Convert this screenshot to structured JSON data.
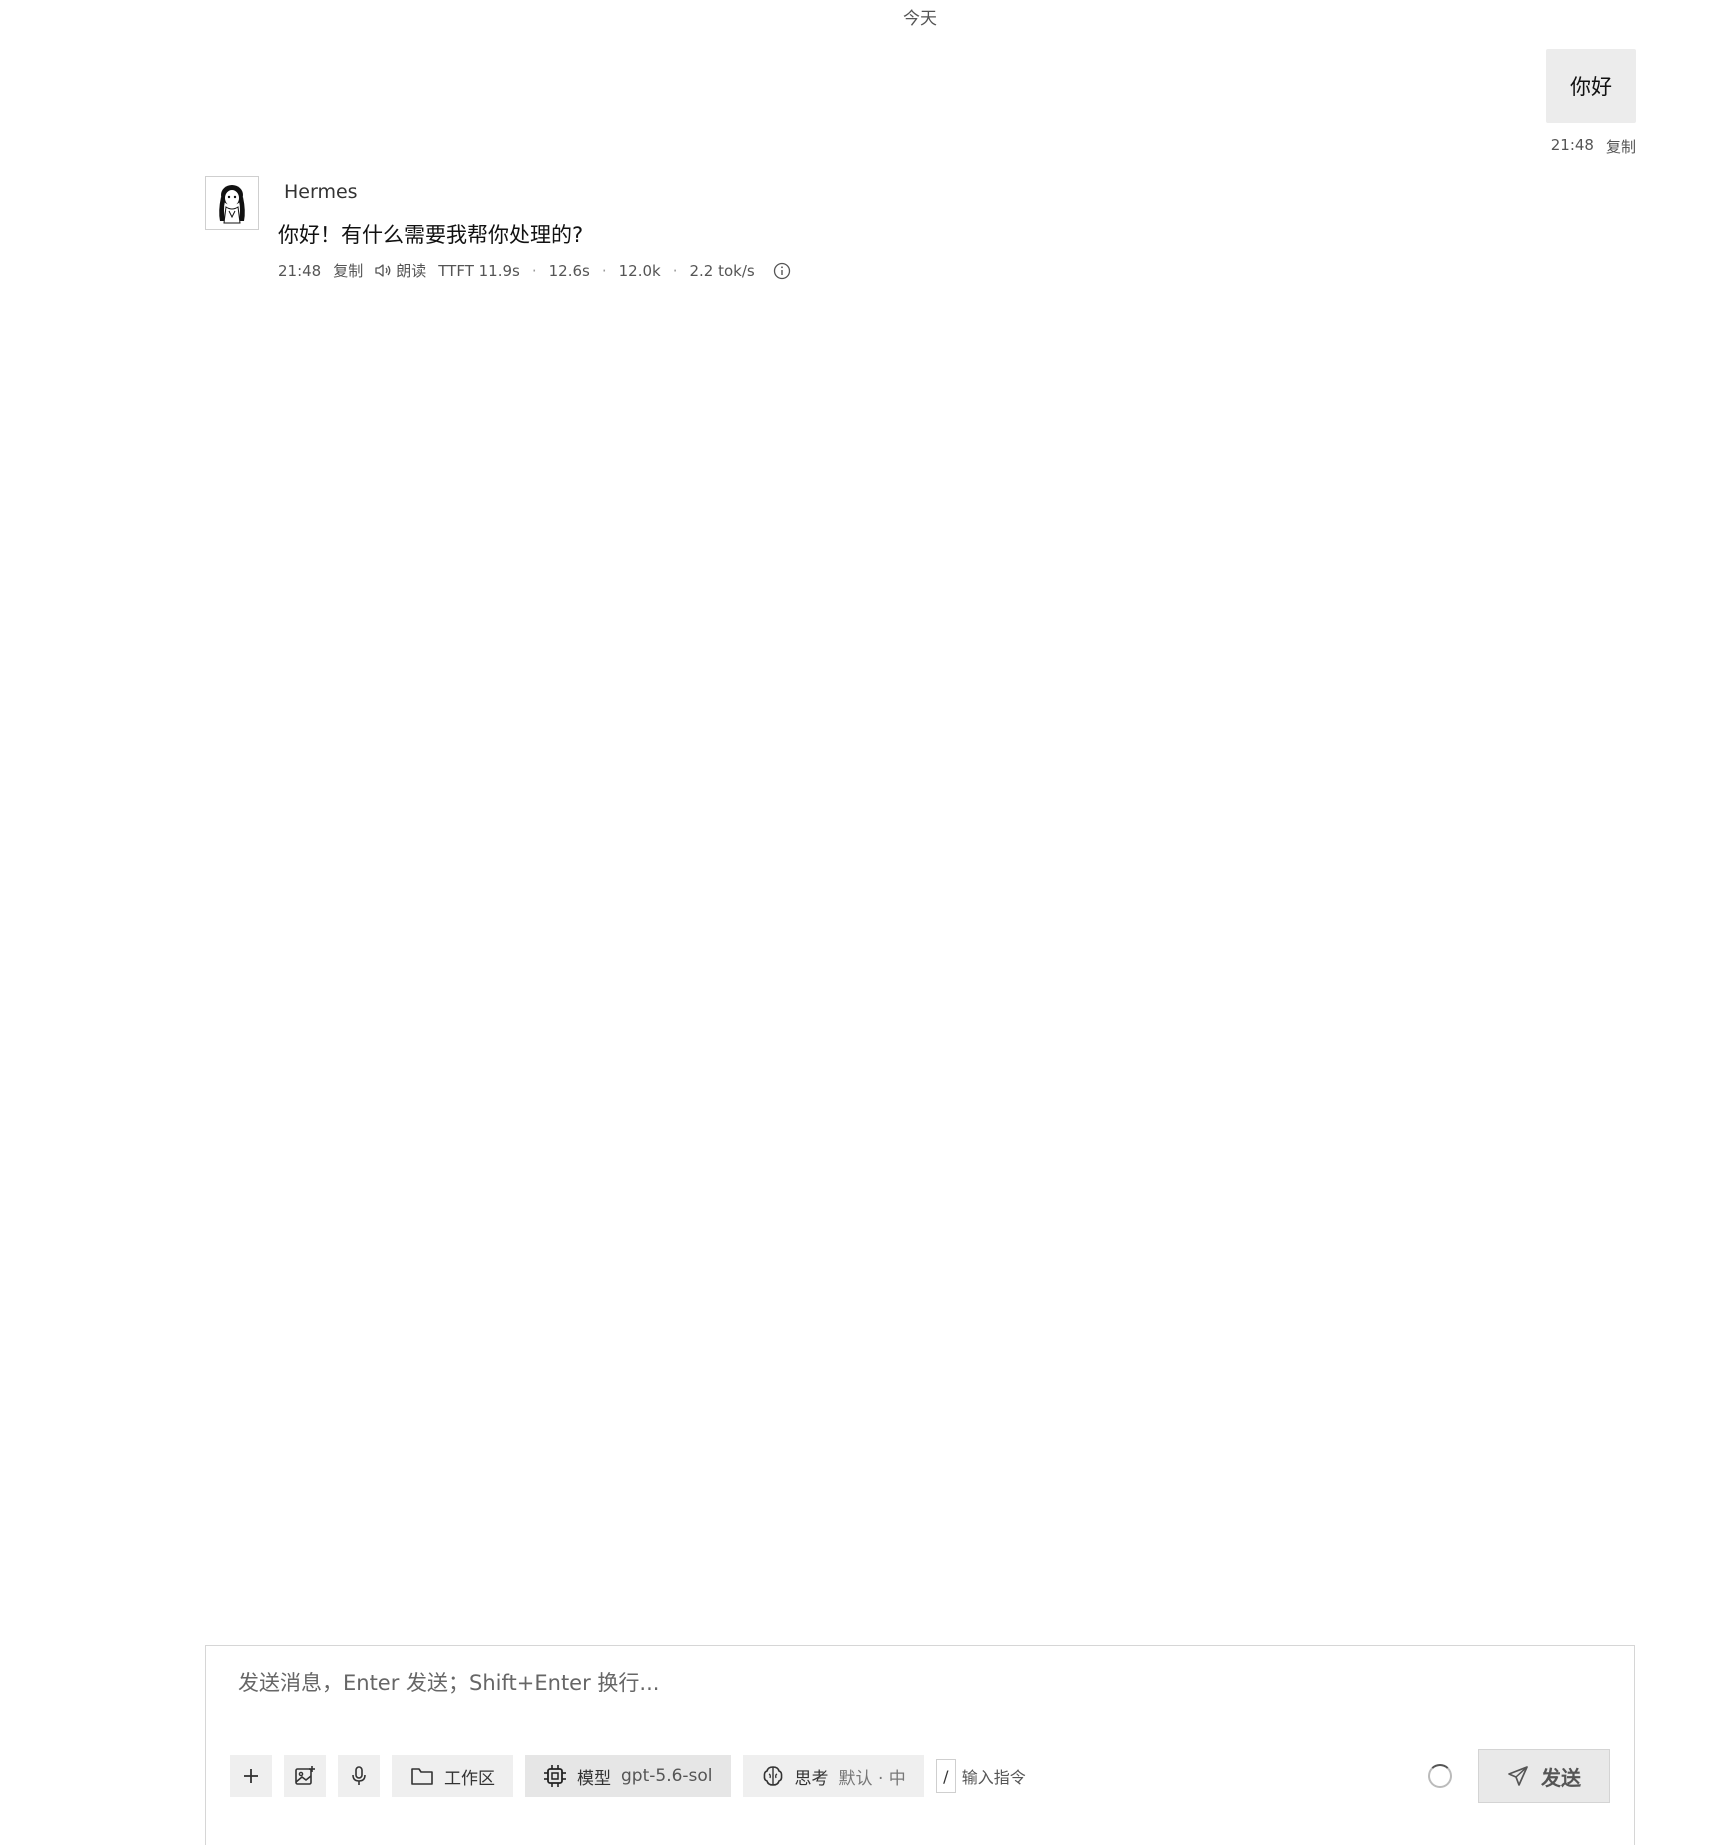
{
  "chat": {
    "date_divider": "今天",
    "user_message": {
      "text": "你好",
      "time": "21:48",
      "copy_label": "复制"
    },
    "assistant_message": {
      "name": "Hermes",
      "text": "你好！有什么需要我帮你处理的?",
      "time": "21:48",
      "copy_label": "复制",
      "read_aloud_label": "朗读",
      "ttft": "TTFT 11.9s",
      "duration": "12.6s",
      "tokens": "12.0k",
      "speed": "2.2 tok/s",
      "separator": "·"
    }
  },
  "composer": {
    "placeholder": "发送消息，Enter 发送；Shift+Enter 换行...",
    "workspace_label": "工作区",
    "model_label": "模型",
    "model_value": "gpt-5.6-sol",
    "thinking_label": "思考",
    "thinking_value": "默认 · 中",
    "slash_key": "/",
    "command_hint": "输入指令",
    "send_label": "发送"
  },
  "icons": {
    "add": "plus-icon",
    "image": "image-add-icon",
    "mic": "microphone-icon",
    "folder": "folder-icon",
    "model": "cpu-chip-icon",
    "thinking": "brain-icon",
    "send": "paper-plane-icon",
    "info": "info-circle-icon",
    "speaker": "speaker-icon",
    "avatar": "girl-avatar-icon"
  }
}
